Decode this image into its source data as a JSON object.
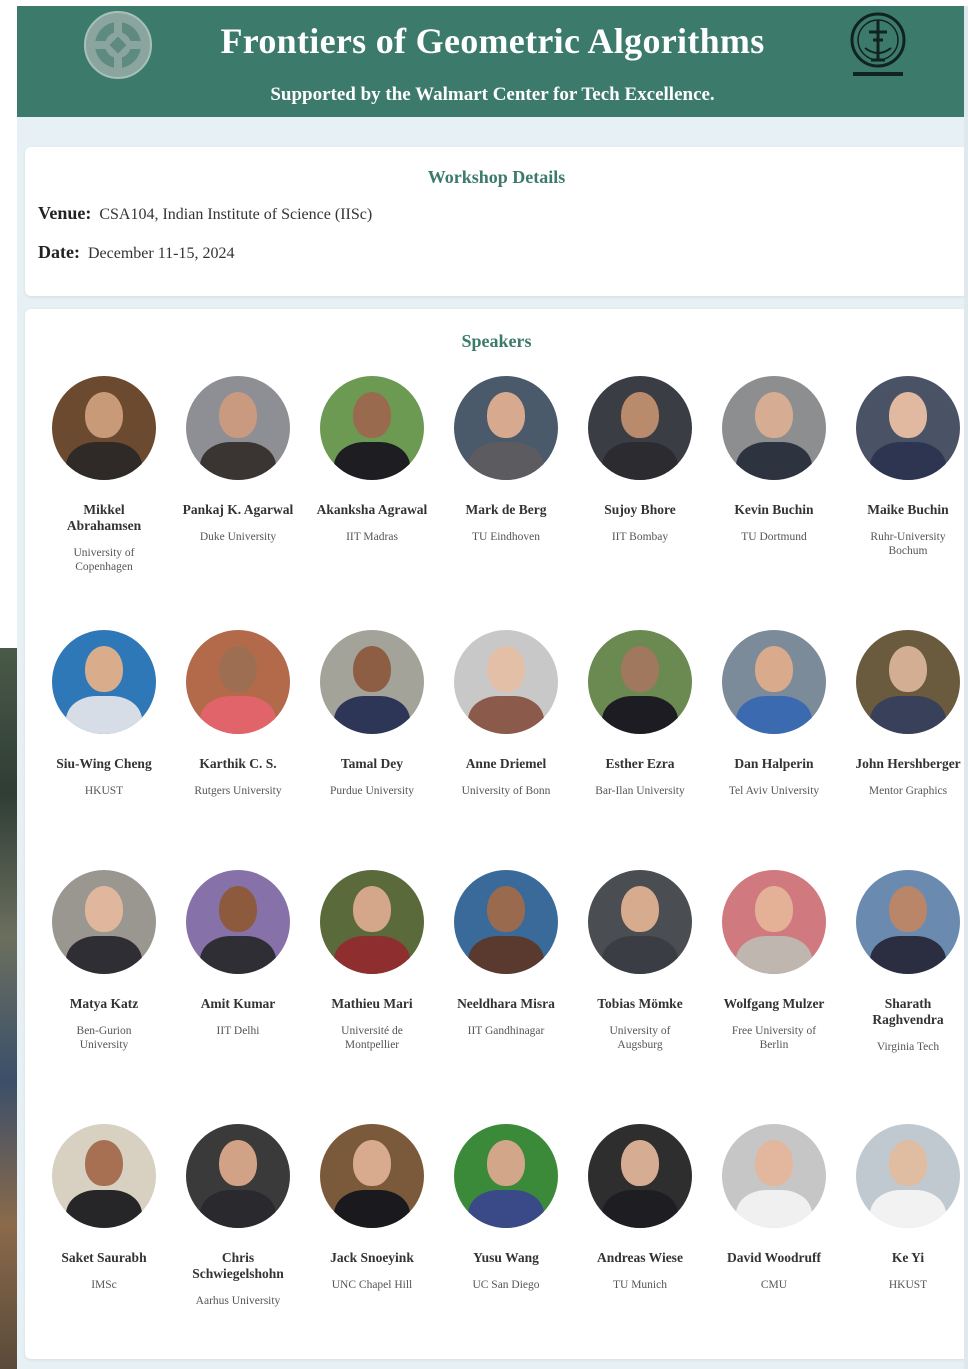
{
  "header": {
    "title": "Frontiers of Geometric Algorithms",
    "subtitle": "Supported by the Walmart Center for Tech Excellence."
  },
  "details": {
    "heading": "Workshop Details",
    "venue_label": "Venue:",
    "venue_value": "CSA104, Indian Institute of Science (IISc)",
    "date_label": "Date:",
    "date_value": "December 11-15, 2024"
  },
  "speakers": {
    "heading": "Speakers",
    "items": [
      {
        "name": "Mikkel Abrahamsen",
        "affiliation": "University of Copenhagen"
      },
      {
        "name": "Pankaj K. Agarwal",
        "affiliation": "Duke University"
      },
      {
        "name": "Akanksha Agrawal",
        "affiliation": "IIT Madras"
      },
      {
        "name": "Mark de Berg",
        "affiliation": "TU Eindhoven"
      },
      {
        "name": "Sujoy Bhore",
        "affiliation": "IIT Bombay"
      },
      {
        "name": "Kevin Buchin",
        "affiliation": "TU Dortmund"
      },
      {
        "name": "Maike Buchin",
        "affiliation": "Ruhr-University Bochum"
      },
      {
        "name": "Siu-Wing Cheng",
        "affiliation": "HKUST"
      },
      {
        "name": "Karthik C. S.",
        "affiliation": "Rutgers University"
      },
      {
        "name": "Tamal Dey",
        "affiliation": "Purdue University"
      },
      {
        "name": "Anne Driemel",
        "affiliation": "University of Bonn"
      },
      {
        "name": "Esther Ezra",
        "affiliation": "Bar-Ilan University"
      },
      {
        "name": "Dan Halperin",
        "affiliation": "Tel Aviv University"
      },
      {
        "name": "John Hershberger",
        "affiliation": "Mentor Graphics"
      },
      {
        "name": "Matya Katz",
        "affiliation": "Ben-Gurion University"
      },
      {
        "name": "Amit Kumar",
        "affiliation": "IIT Delhi"
      },
      {
        "name": "Mathieu Mari",
        "affiliation": "Université de Montpellier"
      },
      {
        "name": "Neeldhara Misra",
        "affiliation": "IIT Gandhinagar"
      },
      {
        "name": "Tobias Mömke",
        "affiliation": "University of Augsburg"
      },
      {
        "name": "Wolfgang Mulzer",
        "affiliation": "Free University of Berlin"
      },
      {
        "name": "Sharath Raghvendra",
        "affiliation": "Virginia Tech"
      },
      {
        "name": "Saket Saurabh",
        "affiliation": "IMSc"
      },
      {
        "name": "Chris Schwiegelshohn",
        "affiliation": "Aarhus University"
      },
      {
        "name": "Jack Snoeyink",
        "affiliation": "UNC Chapel Hill"
      },
      {
        "name": "Yusu Wang",
        "affiliation": "UC San Diego"
      },
      {
        "name": "Andreas Wiese",
        "affiliation": "TU Munich"
      },
      {
        "name": "David Woodruff",
        "affiliation": "CMU"
      },
      {
        "name": "Ke Yi",
        "affiliation": "HKUST"
      }
    ]
  },
  "colors": {
    "header_bg": "#3c7a6b",
    "accent": "#3c7a6b",
    "page_bg": "#e7f0f4"
  }
}
